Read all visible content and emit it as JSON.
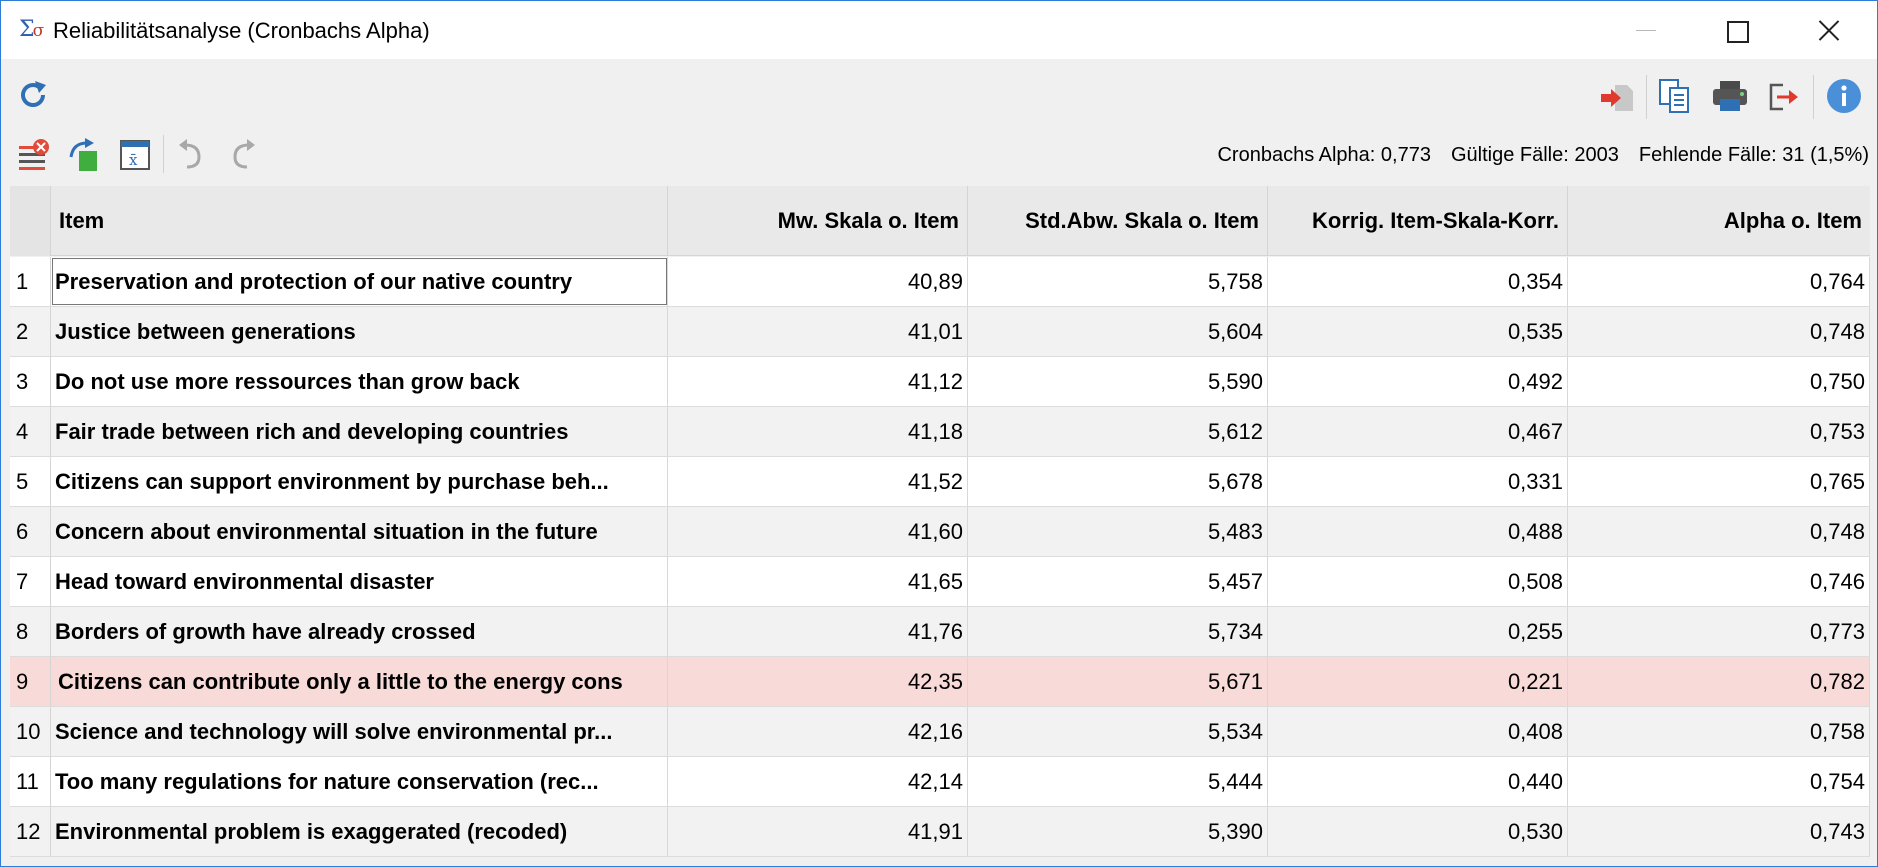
{
  "window": {
    "title": "Reliabilitätsanalyse (Cronbachs Alpha)",
    "border_color": "#2f7cd6"
  },
  "toolbar": {
    "refresh_icon": "refresh-icon",
    "export_icon": "import-arrow-icon",
    "copy_icon": "copy-icon",
    "print_icon": "printer-icon",
    "exit_icon": "exit-icon",
    "info_icon": "info-icon",
    "remove_icon": "remove-list-icon",
    "excel_icon": "excel-export-icon",
    "formula_icon": "formula-window-icon",
    "undo_icon": "undo-icon",
    "redo_icon": "redo-icon"
  },
  "stats": {
    "alpha": "Cronbachs Alpha: 0,773",
    "valid": "Gültige Fälle: 2003",
    "missing": "Fehlende Fälle: 31 (1,5%)"
  },
  "table": {
    "headers": [
      "Item",
      "Mw. Skala o. Item",
      "Std.Abw. Skala o. Item",
      "Korrig. Item-Skala-Korr.",
      "Alpha o. Item"
    ],
    "rows": [
      {
        "n": "1",
        "item": "Preservation and protection of our native country",
        "mw": "40,89",
        "sd": "5,758",
        "korr": "0,354",
        "alpha": "0,764"
      },
      {
        "n": "2",
        "item": "Justice between generations",
        "mw": "41,01",
        "sd": "5,604",
        "korr": "0,535",
        "alpha": "0,748"
      },
      {
        "n": "3",
        "item": "Do not use more ressources than grow back",
        "mw": "41,12",
        "sd": "5,590",
        "korr": "0,492",
        "alpha": "0,750"
      },
      {
        "n": "4",
        "item": "Fair trade between rich and developing countries",
        "mw": "41,18",
        "sd": "5,612",
        "korr": "0,467",
        "alpha": "0,753"
      },
      {
        "n": "5",
        "item": "Citizens can support environment by purchase beh...",
        "mw": "41,52",
        "sd": "5,678",
        "korr": "0,331",
        "alpha": "0,765"
      },
      {
        "n": "6",
        "item": "Concern about environmental situation in the future",
        "mw": "41,60",
        "sd": "5,483",
        "korr": "0,488",
        "alpha": "0,748"
      },
      {
        "n": "7",
        "item": "Head toward environmental disaster",
        "mw": "41,65",
        "sd": "5,457",
        "korr": "0,508",
        "alpha": "0,746"
      },
      {
        "n": "8",
        "item": "Borders of growth have already crossed",
        "mw": "41,76",
        "sd": "5,734",
        "korr": "0,255",
        "alpha": "0,773"
      },
      {
        "n": "9",
        "item": "Citizens can contribute only a little to the energy cons",
        "mw": "42,35",
        "sd": "5,671",
        "korr": "0,221",
        "alpha": "0,782"
      },
      {
        "n": "10",
        "item": "Science and technology will solve environmental pr...",
        "mw": "42,16",
        "sd": "5,534",
        "korr": "0,408",
        "alpha": "0,758"
      },
      {
        "n": "11",
        "item": "Too many regulations for nature conservation (rec...",
        "mw": "42,14",
        "sd": "5,444",
        "korr": "0,440",
        "alpha": "0,754"
      },
      {
        "n": "12",
        "item": "Environmental problem is exaggerated (recoded)",
        "mw": "41,91",
        "sd": "5,390",
        "korr": "0,530",
        "alpha": "0,743"
      }
    ],
    "highlight_color": "#f8dbd8"
  }
}
